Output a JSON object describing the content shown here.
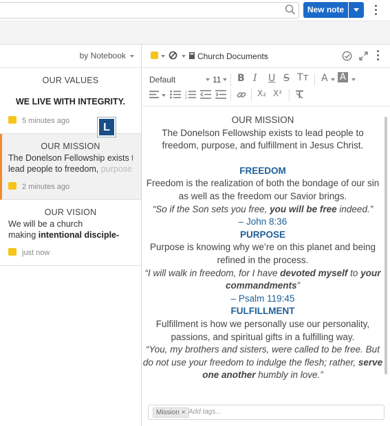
{
  "topbar": {
    "new_note_label": "New note"
  },
  "list": {
    "sort_label": "by Notebook",
    "notes": [
      {
        "title": "OUR VALUES",
        "snippet_pre": "",
        "snippet_bold": "WE LIVE WITH INTEG",
        "snippet_fade": "RITY.",
        "snippet_line2": "",
        "time": "5 minutes ago"
      },
      {
        "title": "OUR MISSION",
        "snippet_pre": "The Donelson Fellowship exists to",
        "snippet_line2": "lead people to freedom, ",
        "snippet_fade": "purpose",
        "time": "2 minutes ago"
      },
      {
        "title": "OUR VISION",
        "snippet_pre": "We will be a church",
        "snippet_line2_pre": "making ",
        "snippet_bold": "intentional disci",
        "snippet_fade": "ple-",
        "time": "just now"
      }
    ],
    "badge_letter": "L"
  },
  "editor": {
    "notebook": "Church Documents",
    "font": "Default",
    "font_size": "11",
    "sub_label": "X₂",
    "sup_label": "X²",
    "content": {
      "title": "OUR MISSION",
      "intro": "The Donelson Fellowship exists to lead people to freedom, purpose, and fulfillment in Jesus Christ.",
      "freedom_h": "FREEDOM",
      "freedom_p": "Freedom is the realization of both the bondage of our sin as well as the freedom our Savior brings.",
      "freedom_q1": "“So if the Son sets you free, ",
      "freedom_q_bold": "you will be free",
      "freedom_q2": " indeed.”",
      "freedom_ref": "– John 8:36",
      "purpose_h": "PURPOSE",
      "purpose_p": "Purpose is knowing why we’re on this planet and being refined in the process.",
      "purpose_q1": "“I will walk in freedom, for I have ",
      "purpose_q_b1": "devoted myself",
      "purpose_q2": " to ",
      "purpose_q_b2": "your commandments",
      "purpose_q3": "”",
      "purpose_ref": "– Psalm 119:45",
      "fulfill_h": "FULFILLMENT",
      "fulfill_p": "Fulfillment is how we personally use our personality, passions, and spiritual gifts in a fulfilling way.",
      "fulfill_q1": "“You, my brothers and sisters, were called to be free. But do not use your freedom to indulge the flesh; rather, ",
      "fulfill_q_bold": "serve one another",
      "fulfill_q2": " humbly in love.”"
    },
    "tag": "Mission",
    "tag_remove": "×",
    "tag_placeholder": "Add tags..."
  },
  "colors": {
    "accent": "#1b6ac9",
    "selected_border": "#f08c2e",
    "heading": "#1f5f99",
    "sticky": "#f5c518"
  }
}
